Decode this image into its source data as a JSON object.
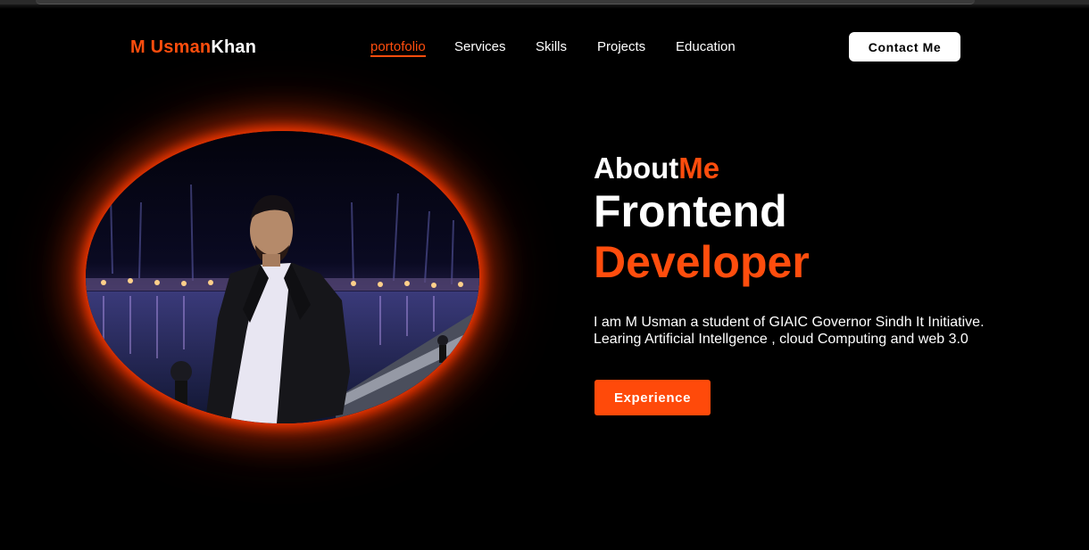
{
  "colors": {
    "accent": "#ff4d0d",
    "background": "#000000",
    "text": "#ffffff"
  },
  "logo": {
    "first": "M Usman",
    "second": "Khan"
  },
  "nav": {
    "items": [
      {
        "label": "portofolio",
        "active": true
      },
      {
        "label": "Services"
      },
      {
        "label": "Skills"
      },
      {
        "label": "Projects"
      },
      {
        "label": "Education"
      }
    ]
  },
  "header": {
    "contact_label": "Contact Me"
  },
  "hero": {
    "about_white": "About",
    "about_orange": "Me",
    "title_line1": "Frontend",
    "title_line2": "Developer",
    "description_line1": "I am M Usman a student of GIAIC Governor Sindh It Initiative.",
    "description_line2": "Learing Artificial Intellgence , cloud Computing and web 3.0",
    "button_label": "Experience"
  }
}
